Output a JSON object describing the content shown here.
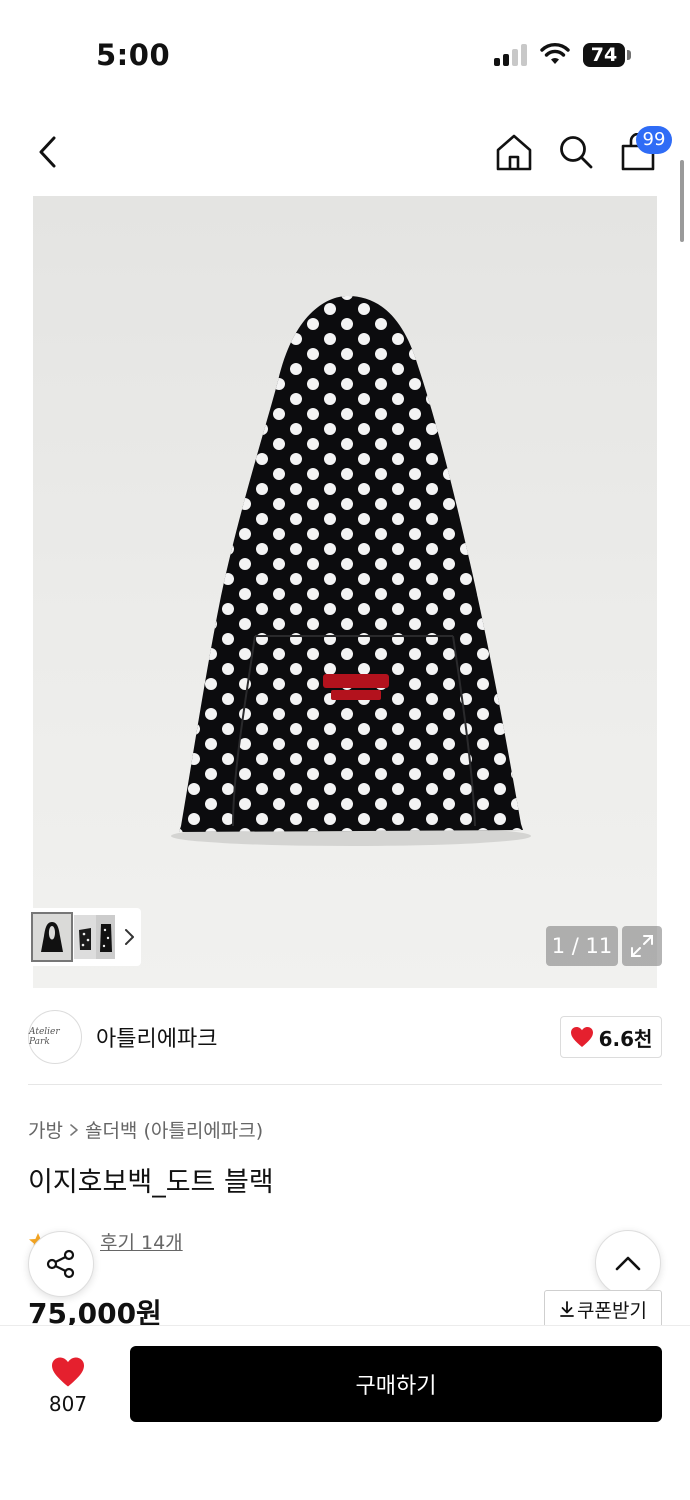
{
  "status_bar": {
    "time": "5:00",
    "battery": "74",
    "icons": [
      "cellular-signal-icon",
      "wifi-icon",
      "battery-icon"
    ]
  },
  "nav": {
    "back_icon": "chevron-left-icon",
    "home_icon": "home-icon",
    "search_icon": "search-icon",
    "cart_icon": "shopping-bag-icon",
    "cart_badge": "99",
    "badge_color": "#2f6cf6"
  },
  "gallery": {
    "counter": "1 / 11",
    "expand_icon": "expand-arrows-icon",
    "thumb_arrow_icon": "chevron-right-icon"
  },
  "brand": {
    "logo_text": "Atelier Park",
    "name": "아틀리에파크",
    "like_count": "6.6천",
    "like_color": "#e5202e"
  },
  "product": {
    "breadcrumb": [
      "가방",
      "숄더백 (아틀리에파크)"
    ],
    "title": "이지호보백_도트 블랙",
    "review_text": "후기 14개",
    "price": "75,000원",
    "coupon_label": "쿠폰받기"
  },
  "bottom_bar": {
    "wish_count": "807",
    "buy_label": "구매하기"
  }
}
